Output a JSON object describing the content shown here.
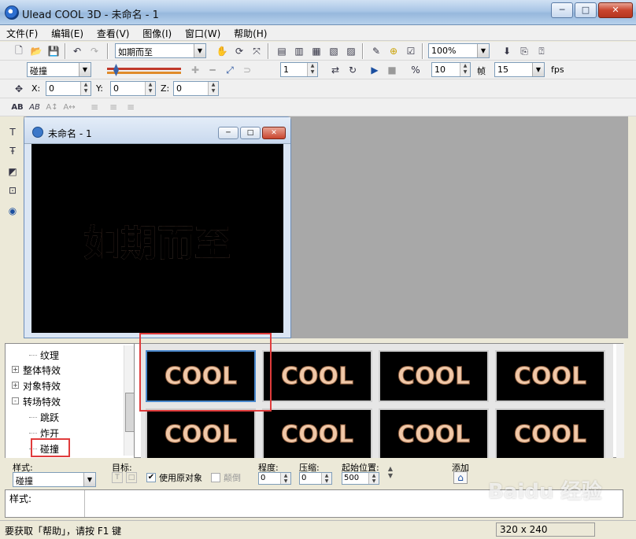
{
  "window": {
    "title": "Ulead COOL 3D - 未命名 - 1",
    "minimize": "─",
    "maximize": "□",
    "close": "✕"
  },
  "menu": [
    "文件(F)",
    "编辑(E)",
    "查看(V)",
    "图像(I)",
    "窗口(W)",
    "帮助(H)"
  ],
  "toolbar1": {
    "text_combo": "如期而至",
    "zoom_combo": "100%"
  },
  "toolbar2": {
    "effect_combo": "碰撞",
    "frame_value": "1",
    "fps_frames": "10",
    "frame_label": "帧",
    "fps_value": "15",
    "fps_label": "fps"
  },
  "toolbar3": {
    "x_label": "X:",
    "x_value": "0",
    "y_label": "Y:",
    "y_value": "0",
    "z_label": "Z:",
    "z_value": "0"
  },
  "toolbar4": {
    "b1": "AB",
    "b2": "AB",
    "b3": "A↕",
    "b4": "A↔"
  },
  "document": {
    "title": "未命名 - 1",
    "canvas_text": "如期而至"
  },
  "tree": {
    "items": [
      {
        "label": "纹理",
        "expandable": false
      },
      {
        "label": "整体特效",
        "expandable": true,
        "sign": "+"
      },
      {
        "label": "对象特效",
        "expandable": true,
        "sign": "+"
      },
      {
        "label": "转场特效",
        "expandable": true,
        "sign": "-"
      },
      {
        "label": "跳跃",
        "expandable": false
      },
      {
        "label": "炸开",
        "expandable": false
      },
      {
        "label": "碰撞",
        "expandable": false
      }
    ]
  },
  "gallery": {
    "thumbs": [
      {
        "text": "COOL"
      },
      {
        "text": "COOL"
      },
      {
        "text": "COOL"
      },
      {
        "text": "COOL"
      },
      {
        "text": "COOL"
      },
      {
        "text": "COOL"
      },
      {
        "text": "COOL"
      },
      {
        "text": "COOL"
      }
    ],
    "row1_prefix": "C",
    "row2_prefix2": "☞",
    "row2_prefix1": "➔"
  },
  "options": {
    "style_label": "样式:",
    "style_value": "碰撞",
    "target_label": "目标:",
    "target_t": "T",
    "target_box": "□",
    "use_original_label": "使用原对象",
    "use_original_checked": "✔",
    "reverse_label": "颠倒",
    "degree_label": "程度:",
    "degree_value": "0",
    "compress_label": "压缩:",
    "compress_value": "0",
    "start_label": "起始位置:",
    "start_value": "500",
    "add_label": "添加"
  },
  "description": {
    "label": "样式:"
  },
  "status": {
    "text": "要获取「帮助」，请按 F1 键",
    "size": "320 x 240"
  },
  "watermark": "Baidu 经验"
}
